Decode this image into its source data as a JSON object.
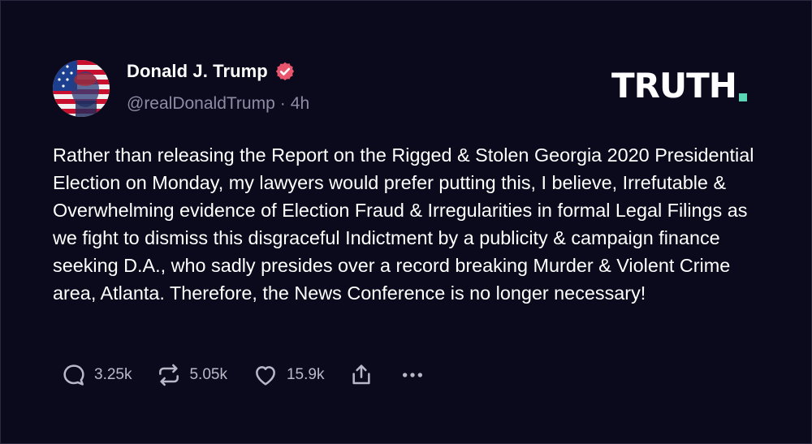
{
  "post": {
    "author_name": "Donald J. Trump",
    "handle": "@realDonaldTrump",
    "separator": "·",
    "time_ago": "4h",
    "body": "Rather than releasing the Report on the Rigged & Stolen Georgia 2020 Presidential Election on Monday, my lawyers would prefer putting this, I believe, Irrefutable & Overwhelming evidence of Election Fraud & Irregularities in formal Legal Filings as we fight to dismiss this disgraceful Indictment by a publicity & campaign finance seeking D.A., who sadly presides over a record breaking Murder & Violent Crime area, Atlanta. Therefore, the News Conference is no longer necessary!"
  },
  "brand": {
    "logo_text": "TRUTH",
    "logo_accent": "#5bd6b5"
  },
  "actions": {
    "replies": "3.25k",
    "retruths": "5.05k",
    "likes": "15.9k"
  },
  "icons": {
    "verified": "verified-badge-icon",
    "reply": "reply-bubble-icon",
    "retruth": "retruth-arrows-icon",
    "like": "heart-icon",
    "share": "share-icon",
    "more": "more-dots-icon"
  },
  "colors": {
    "background": "#0b0a1c",
    "secondary_text": "#8e8ca5",
    "verified_badge": "#e8556d"
  }
}
